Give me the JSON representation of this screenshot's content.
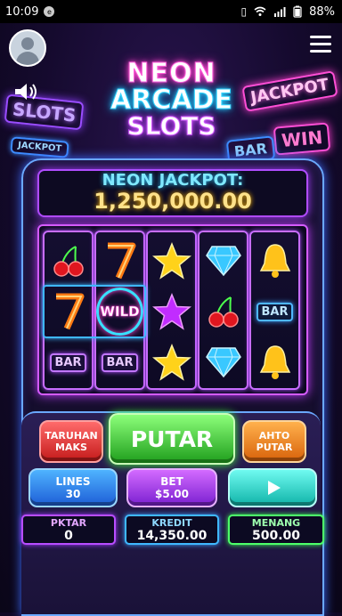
{
  "status_bar": {
    "time": "10:09",
    "battery": "88%"
  },
  "logo": {
    "line1": "NEON",
    "line2": "ARCADE",
    "line3": "SLOTS"
  },
  "background_signs": {
    "slots": "SLOTS",
    "jackpot_right": "JACKPOT",
    "win": "WIN",
    "bar": "BAR",
    "jackpot_left": "JACKPOT"
  },
  "jackpot": {
    "label": "NEON JACKPOT:",
    "value": "1,250,000.00"
  },
  "reels": [
    [
      "cherry",
      "seven",
      "bar"
    ],
    [
      "seven",
      "wild",
      "bar"
    ],
    [
      "star",
      "star",
      "star"
    ],
    [
      "diamond",
      "cherry",
      "diamond"
    ],
    [
      "bell",
      "bar",
      "bell"
    ]
  ],
  "symbols": {
    "bar_label": "BAR",
    "wild_label": "WILD"
  },
  "controls": {
    "max_bet": "TARUHAN\nMAKS",
    "spin": "PUTAR",
    "auto": "AHTO\nPUTAR",
    "lines_label": "LINES",
    "lines_value": "30",
    "bet_label": "BET",
    "bet_value": "$5.00",
    "play_icon": "play-icon"
  },
  "stats": {
    "putar_label": "PKTAR",
    "putar_value": "0",
    "kredit_label": "KREDIT",
    "kredit_value": "14,350.00",
    "menang_label": "MENANG",
    "menang_value": "500.00"
  },
  "colors": {
    "accent_pink": "#ff4fd6",
    "accent_cyan": "#35d7ff",
    "accent_purple": "#b04cff",
    "jackpot_gold": "#ffe28a"
  }
}
